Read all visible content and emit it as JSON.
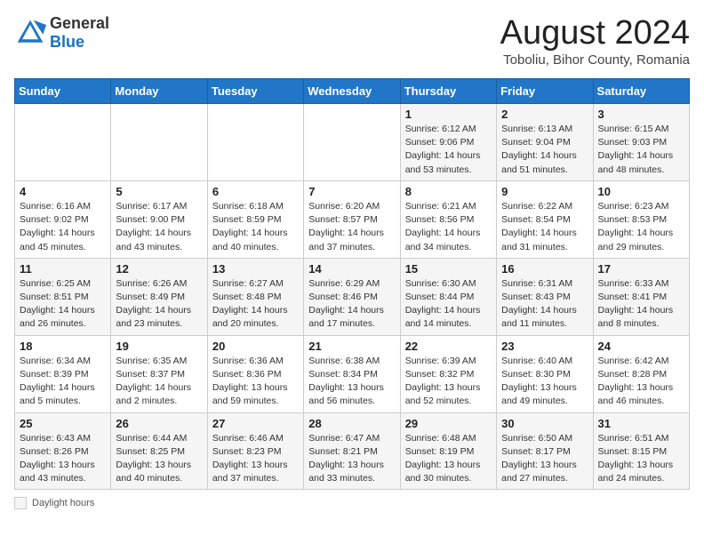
{
  "header": {
    "logo_general": "General",
    "logo_blue": "Blue",
    "month_title": "August 2024",
    "subtitle": "Toboliu, Bihor County, Romania"
  },
  "days_of_week": [
    "Sunday",
    "Monday",
    "Tuesday",
    "Wednesday",
    "Thursday",
    "Friday",
    "Saturday"
  ],
  "weeks": [
    [
      {
        "day": "",
        "info": ""
      },
      {
        "day": "",
        "info": ""
      },
      {
        "day": "",
        "info": ""
      },
      {
        "day": "",
        "info": ""
      },
      {
        "day": "1",
        "info": "Sunrise: 6:12 AM\nSunset: 9:06 PM\nDaylight: 14 hours and 53 minutes."
      },
      {
        "day": "2",
        "info": "Sunrise: 6:13 AM\nSunset: 9:04 PM\nDaylight: 14 hours and 51 minutes."
      },
      {
        "day": "3",
        "info": "Sunrise: 6:15 AM\nSunset: 9:03 PM\nDaylight: 14 hours and 48 minutes."
      }
    ],
    [
      {
        "day": "4",
        "info": "Sunrise: 6:16 AM\nSunset: 9:02 PM\nDaylight: 14 hours and 45 minutes."
      },
      {
        "day": "5",
        "info": "Sunrise: 6:17 AM\nSunset: 9:00 PM\nDaylight: 14 hours and 43 minutes."
      },
      {
        "day": "6",
        "info": "Sunrise: 6:18 AM\nSunset: 8:59 PM\nDaylight: 14 hours and 40 minutes."
      },
      {
        "day": "7",
        "info": "Sunrise: 6:20 AM\nSunset: 8:57 PM\nDaylight: 14 hours and 37 minutes."
      },
      {
        "day": "8",
        "info": "Sunrise: 6:21 AM\nSunset: 8:56 PM\nDaylight: 14 hours and 34 minutes."
      },
      {
        "day": "9",
        "info": "Sunrise: 6:22 AM\nSunset: 8:54 PM\nDaylight: 14 hours and 31 minutes."
      },
      {
        "day": "10",
        "info": "Sunrise: 6:23 AM\nSunset: 8:53 PM\nDaylight: 14 hours and 29 minutes."
      }
    ],
    [
      {
        "day": "11",
        "info": "Sunrise: 6:25 AM\nSunset: 8:51 PM\nDaylight: 14 hours and 26 minutes."
      },
      {
        "day": "12",
        "info": "Sunrise: 6:26 AM\nSunset: 8:49 PM\nDaylight: 14 hours and 23 minutes."
      },
      {
        "day": "13",
        "info": "Sunrise: 6:27 AM\nSunset: 8:48 PM\nDaylight: 14 hours and 20 minutes."
      },
      {
        "day": "14",
        "info": "Sunrise: 6:29 AM\nSunset: 8:46 PM\nDaylight: 14 hours and 17 minutes."
      },
      {
        "day": "15",
        "info": "Sunrise: 6:30 AM\nSunset: 8:44 PM\nDaylight: 14 hours and 14 minutes."
      },
      {
        "day": "16",
        "info": "Sunrise: 6:31 AM\nSunset: 8:43 PM\nDaylight: 14 hours and 11 minutes."
      },
      {
        "day": "17",
        "info": "Sunrise: 6:33 AM\nSunset: 8:41 PM\nDaylight: 14 hours and 8 minutes."
      }
    ],
    [
      {
        "day": "18",
        "info": "Sunrise: 6:34 AM\nSunset: 8:39 PM\nDaylight: 14 hours and 5 minutes."
      },
      {
        "day": "19",
        "info": "Sunrise: 6:35 AM\nSunset: 8:37 PM\nDaylight: 14 hours and 2 minutes."
      },
      {
        "day": "20",
        "info": "Sunrise: 6:36 AM\nSunset: 8:36 PM\nDaylight: 13 hours and 59 minutes."
      },
      {
        "day": "21",
        "info": "Sunrise: 6:38 AM\nSunset: 8:34 PM\nDaylight: 13 hours and 56 minutes."
      },
      {
        "day": "22",
        "info": "Sunrise: 6:39 AM\nSunset: 8:32 PM\nDaylight: 13 hours and 52 minutes."
      },
      {
        "day": "23",
        "info": "Sunrise: 6:40 AM\nSunset: 8:30 PM\nDaylight: 13 hours and 49 minutes."
      },
      {
        "day": "24",
        "info": "Sunrise: 6:42 AM\nSunset: 8:28 PM\nDaylight: 13 hours and 46 minutes."
      }
    ],
    [
      {
        "day": "25",
        "info": "Sunrise: 6:43 AM\nSunset: 8:26 PM\nDaylight: 13 hours and 43 minutes."
      },
      {
        "day": "26",
        "info": "Sunrise: 6:44 AM\nSunset: 8:25 PM\nDaylight: 13 hours and 40 minutes."
      },
      {
        "day": "27",
        "info": "Sunrise: 6:46 AM\nSunset: 8:23 PM\nDaylight: 13 hours and 37 minutes."
      },
      {
        "day": "28",
        "info": "Sunrise: 6:47 AM\nSunset: 8:21 PM\nDaylight: 13 hours and 33 minutes."
      },
      {
        "day": "29",
        "info": "Sunrise: 6:48 AM\nSunset: 8:19 PM\nDaylight: 13 hours and 30 minutes."
      },
      {
        "day": "30",
        "info": "Sunrise: 6:50 AM\nSunset: 8:17 PM\nDaylight: 13 hours and 27 minutes."
      },
      {
        "day": "31",
        "info": "Sunrise: 6:51 AM\nSunset: 8:15 PM\nDaylight: 13 hours and 24 minutes."
      }
    ]
  ],
  "footer": {
    "daylight_label": "Daylight hours"
  }
}
